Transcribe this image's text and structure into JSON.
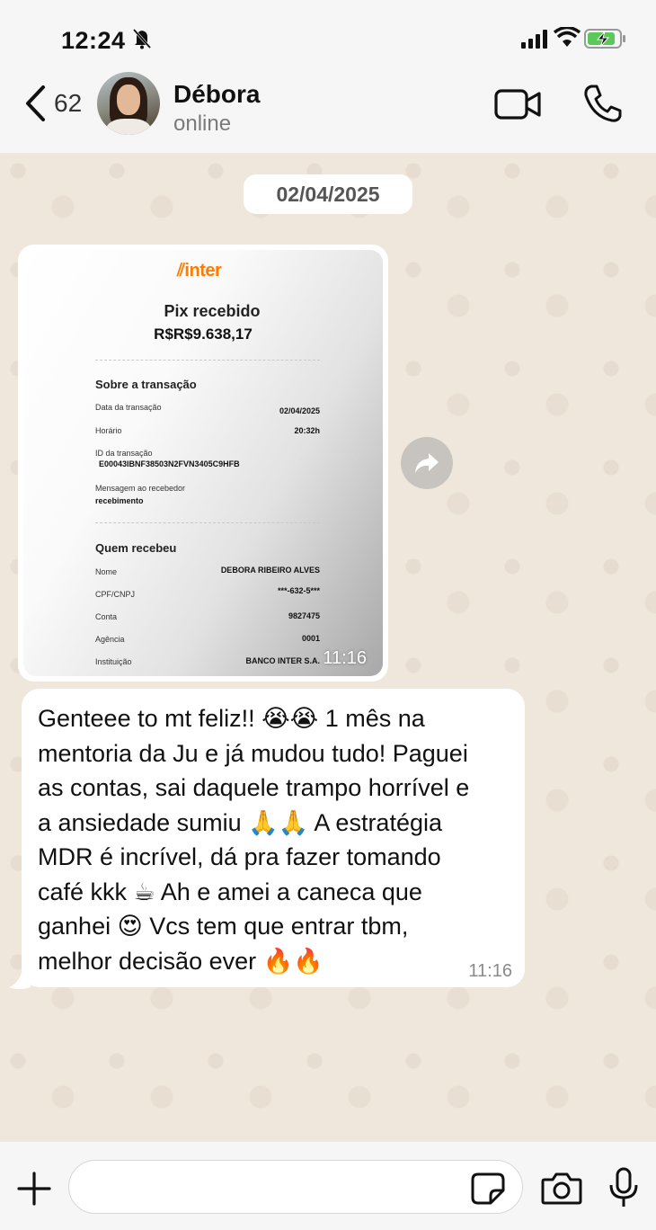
{
  "status_bar": {
    "time": "12:24"
  },
  "header": {
    "back_count": "62",
    "contact_name": "Débora",
    "contact_status": "online"
  },
  "chat": {
    "date_chip": "02/04/2025",
    "image_message": {
      "time": "11:16",
      "receipt": {
        "logo": "inter",
        "title": "Pix recebido",
        "amount": "R$R$9.638,17",
        "section_transaction": "Sobre a transação",
        "date_label": "Data da transação",
        "date_value": "02/04/2025",
        "time_label": "Horário",
        "time_value": "20:32h",
        "id_label": "ID da transação",
        "id_value": "E00043IBNF38503N2FVN3405C9HFB",
        "message_label": "Mensagem ao recebedor",
        "message_value": "recebimento",
        "section_receiver": "Quem recebeu",
        "name_label": "Nome",
        "name_value": "DEBORA RIBEIRO ALVES",
        "doc_label": "CPF/CNPJ",
        "doc_value": "***-632-5***",
        "account_label": "Conta",
        "account_value": "9827475",
        "agency_label": "Agência",
        "agency_value": "0001",
        "institution_label": "Instituição",
        "institution_value": "BANCO INTER S.A."
      }
    },
    "text_message": {
      "text": "Genteee to mt feliz!! 😭😭  1 mês na\nmentoria da Ju e já mudou tudo! Paguei\nas contas, sai daquele trampo horrível e\na ansiedade sumiu 🙏🙏 A estratégia\nMDR é incrível, dá pra fazer tomando\ncafé kkk ☕ Ah e amei a caneca que\nganhei 😍 Vcs tem que entrar tbm,\nmelhor decisão ever 🔥🔥",
      "time": "11:16"
    }
  },
  "input_bar": {
    "value": "",
    "placeholder": ""
  },
  "colors": {
    "inter_orange": "#ff7a00",
    "chat_background": "#efe7dc",
    "bubble": "#ffffff"
  },
  "icons": [
    "bell-muted-icon",
    "signal-icon",
    "wifi-icon",
    "battery-charging-icon",
    "back-chevron-icon",
    "video-camera-icon",
    "phone-icon",
    "forward-icon",
    "plus-icon",
    "sticker-icon",
    "camera-icon",
    "microphone-icon"
  ]
}
